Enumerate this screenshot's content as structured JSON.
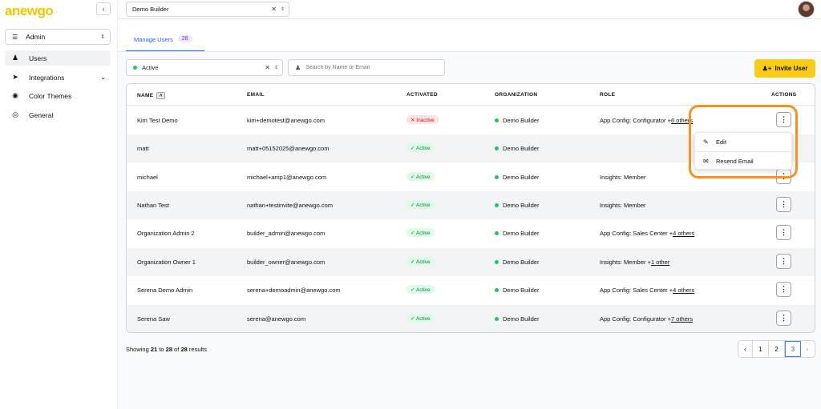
{
  "sidebar": {
    "logo_part1": "anew",
    "logo_part2": "go",
    "collapse_icon": "chevron-left",
    "selector_label": "Admin",
    "items": [
      {
        "label": "Users",
        "icon": "users-icon"
      },
      {
        "label": "Integrations",
        "icon": "send-icon"
      },
      {
        "label": "Color Themes",
        "icon": "palette-icon"
      },
      {
        "label": "General",
        "icon": "globe-icon"
      }
    ]
  },
  "topbar": {
    "org_value": "Demo Builder"
  },
  "tabs": [
    {
      "label": "Manage Users",
      "count": "28"
    }
  ],
  "filters": {
    "status_value": "Active",
    "search_placeholder": "Search by Name or Email"
  },
  "invite_label": "Invite User",
  "table": {
    "headers": {
      "name": "NAME",
      "email": "EMAIL",
      "activated": "ACTIVATED",
      "organization": "ORGANIZATION",
      "role": "ROLE",
      "actions": "ACTIONS"
    },
    "rows": [
      {
        "name": "Kim Test Demo",
        "email": "kim+demotest@anewgo.com",
        "status": "Inactive",
        "status_type": "inactive",
        "org": "Demo Builder",
        "role": "App Config: Configurator +",
        "others": "6 others"
      },
      {
        "name": "matt",
        "email": "matt+05152025@anewgo.com",
        "status": "Active",
        "status_type": "active",
        "org": "Demo Builder",
        "role": "",
        "others": ""
      },
      {
        "name": "michael",
        "email": "michael+amp1@anewgo.com",
        "status": "Active",
        "status_type": "active",
        "org": "Demo Builder",
        "role": "Insights: Member",
        "others": ""
      },
      {
        "name": "Nathan Test",
        "email": "nathan+testinvite@anewgo.com",
        "status": "Active",
        "status_type": "active",
        "org": "Demo Builder",
        "role": "Insights: Member",
        "others": ""
      },
      {
        "name": "Organization Admin 2",
        "email": "builder_admin@anewgo.com",
        "status": "Active",
        "status_type": "active",
        "org": "Demo Builder",
        "role": "App Config: Sales Center +",
        "others": "4 others"
      },
      {
        "name": "Organization Owner 1",
        "email": "builder_owner@anewgo.com",
        "status": "Active",
        "status_type": "active",
        "org": "Demo Builder",
        "role": "Insights: Member +",
        "others": "1 other"
      },
      {
        "name": "Serena Demo Admin",
        "email": "serena+demoadmin@anewgo.com",
        "status": "Active",
        "status_type": "active",
        "org": "Demo Builder",
        "role": "App Config: Sales Center +",
        "others": "4 others"
      },
      {
        "name": "Serena Saw",
        "email": "serena@anewgo.com",
        "status": "Active",
        "status_type": "active",
        "org": "Demo Builder",
        "role": "App Config: Configurator +",
        "others": "7 others"
      }
    ]
  },
  "menu": {
    "items": [
      {
        "label": "Edit",
        "icon": "pencil-icon"
      },
      {
        "label": "Resend Email",
        "icon": "envelope-icon"
      }
    ]
  },
  "footer": {
    "prefix": "Showing",
    "from": "21",
    "to_word": "to",
    "to": "28",
    "of_word": "of",
    "total": "28",
    "suffix": "results"
  },
  "pagination": {
    "pages": [
      "1",
      "2",
      "3"
    ],
    "current": "3"
  },
  "colors": {
    "accent": "#2563eb",
    "invite": "#facc15",
    "highlight": "#f7931e",
    "active_green": "#22c55e",
    "inactive_red": "#b91c1c"
  }
}
